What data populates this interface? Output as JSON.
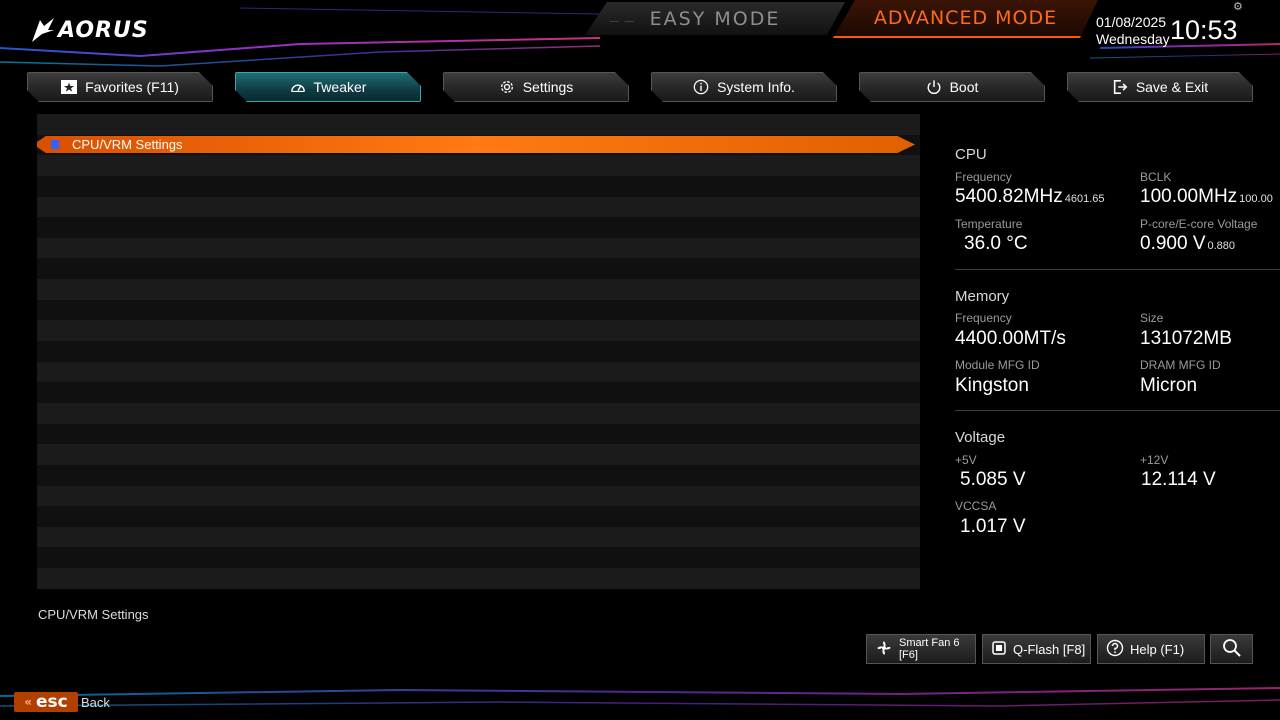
{
  "header": {
    "brand": "AORUS",
    "easy_mode_label": "EASY MODE",
    "advanced_mode_label": "ADVANCED MODE",
    "date": "01/08/2025",
    "weekday": "Wednesday",
    "time": "10:53"
  },
  "tabs": [
    {
      "label": "Favorites (F11)",
      "icon": "star-box-icon",
      "active": false
    },
    {
      "label": "Tweaker",
      "icon": "speedometer-icon",
      "active": true
    },
    {
      "label": "Settings",
      "icon": "gear-icon",
      "active": false
    },
    {
      "label": "System Info.",
      "icon": "info-icon",
      "active": false
    },
    {
      "label": "Boot",
      "icon": "power-icon",
      "active": false
    },
    {
      "label": "Save & Exit",
      "icon": "exit-icon",
      "active": false
    }
  ],
  "list": {
    "selected_item": "CPU/VRM Settings"
  },
  "help_text": "CPU/VRM Settings",
  "cpu": {
    "title": "CPU",
    "frequency_label": "Frequency",
    "frequency_value": "5400.82MHz",
    "frequency_sub": "4601.65",
    "bclk_label": "BCLK",
    "bclk_value": "100.00MHz",
    "bclk_sub": "100.00",
    "temperature_label": "Temperature",
    "temperature_value": "36.0 °C",
    "voltage_label": "P-core/E-core Voltage",
    "voltage_value": "0.900 V",
    "voltage_sub": "0.880"
  },
  "memory": {
    "title": "Memory",
    "frequency_label": "Frequency",
    "frequency_value": "4400.00MT/s",
    "size_label": "Size",
    "size_value": "131072MB",
    "module_label": "Module MFG ID",
    "module_value": "Kingston",
    "dram_label": "DRAM MFG ID",
    "dram_value": "Micron"
  },
  "voltage": {
    "title": "Voltage",
    "v5_label": "+5V",
    "v5_value": "5.085 V",
    "v12_label": "+12V",
    "v12_value": "12.114 V",
    "vccsa_label": "VCCSA",
    "vccsa_value": "1.017 V"
  },
  "bottom": {
    "smartfan_label": "Smart Fan 6 [F6]",
    "qflash_label": "Q-Flash [F8]",
    "help_label": "Help (F1)",
    "esc_label": "esc",
    "back_label": "Back"
  },
  "colors": {
    "accent_orange": "#ff6a1a",
    "active_tab_teal": "#1f6e77",
    "active_tab_corner": "#ff2fb0",
    "selected_row": "#ff7a12"
  }
}
